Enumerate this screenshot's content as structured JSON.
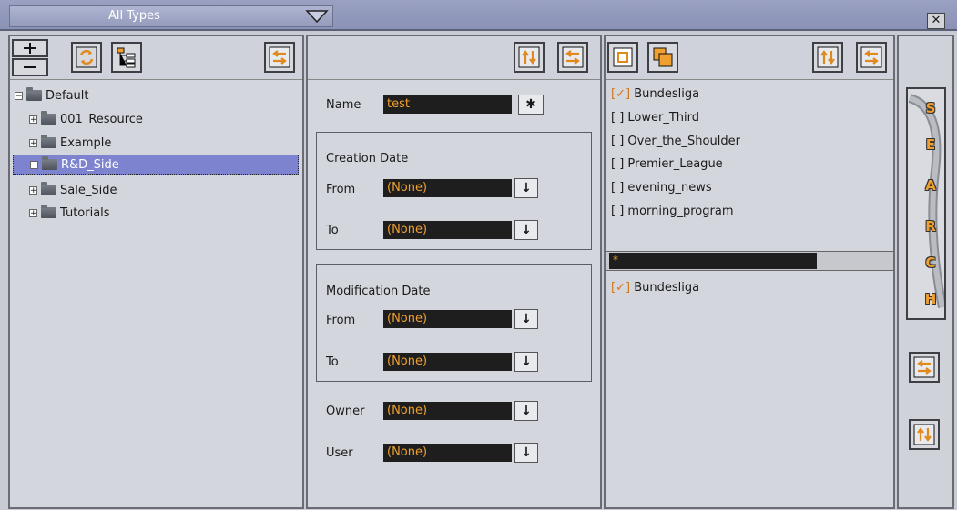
{
  "topbar": {
    "type_filter": "All Types",
    "close_symbol": "✕"
  },
  "tree": {
    "items": [
      {
        "label": "Default",
        "expander": "−"
      },
      {
        "label": "001_Resource",
        "expander": "+"
      },
      {
        "label": "Example",
        "expander": "+"
      },
      {
        "label": "R&D_Side",
        "expander": "+"
      },
      {
        "label": "Sale_Side",
        "expander": "+"
      },
      {
        "label": "Tutorials",
        "expander": "+"
      }
    ],
    "selected": "R&D_Side"
  },
  "form": {
    "name_label": "Name",
    "name_value": "test",
    "wildcard_symbol": "✱",
    "creation": {
      "title": "Creation Date",
      "from_label": "From",
      "from_value": "(None)",
      "to_label": "To",
      "to_value": "(None)"
    },
    "modification": {
      "title": "Modification Date",
      "from_label": "From",
      "from_value": "(None)",
      "to_label": "To",
      "to_value": "(None)"
    },
    "owner_label": "Owner",
    "owner_value": "(None)",
    "user_label": "User",
    "user_value": "(None)",
    "dropdown_symbol": "↓"
  },
  "keywords": {
    "items": [
      {
        "mark": "[✓]",
        "label": "Bundesliga",
        "checked": true
      },
      {
        "mark": "[ ]",
        "label": "Lower_Third",
        "checked": false
      },
      {
        "mark": "[ ]",
        "label": "Over_the_Shoulder",
        "checked": false
      },
      {
        "mark": "[ ]",
        "label": "Premier_League",
        "checked": false
      },
      {
        "mark": "[ ]",
        "label": "evening_news",
        "checked": false
      },
      {
        "mark": "[ ]",
        "label": "morning_program",
        "checked": false
      }
    ],
    "filter_value": "*",
    "results": [
      {
        "mark": "[✓]",
        "label": "Bundesliga"
      }
    ]
  },
  "search": {
    "letters": [
      "S",
      "E",
      "A",
      "R",
      "C",
      "H"
    ]
  },
  "colors": {
    "accent": "#f0a030",
    "selection": "#7d83cf",
    "panel": "#d4d6dd"
  }
}
